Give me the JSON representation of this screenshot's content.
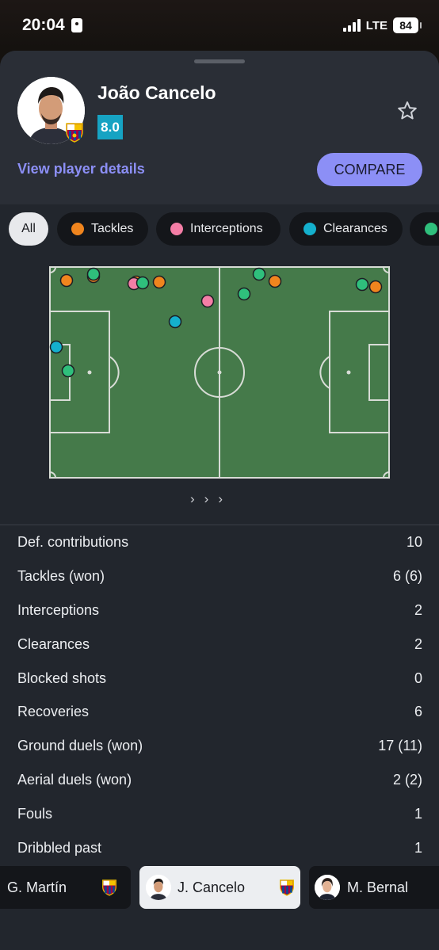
{
  "status_bar": {
    "time": "20:04",
    "network": "LTE",
    "battery": "84"
  },
  "player": {
    "name": "João Cancelo",
    "rating": "8.0",
    "details_link": "View player details",
    "compare_label": "COMPARE"
  },
  "filters": [
    {
      "label": "All",
      "color": ""
    },
    {
      "label": "Tackles",
      "color": "#f0851e"
    },
    {
      "label": "Interceptions",
      "color": "#f47ea6"
    },
    {
      "label": "Clearances",
      "color": "#14b0cd"
    },
    {
      "label": "",
      "color": "#2fbf7c"
    }
  ],
  "stats": [
    {
      "label": "Def. contributions",
      "value": "10"
    },
    {
      "label": "Tackles (won)",
      "value": "6 (6)"
    },
    {
      "label": "Interceptions",
      "value": "2"
    },
    {
      "label": "Clearances",
      "value": "2"
    },
    {
      "label": "Blocked shots",
      "value": "0"
    },
    {
      "label": "Recoveries",
      "value": "6"
    },
    {
      "label": "Ground duels (won)",
      "value": "17 (11)"
    },
    {
      "label": "Aerial duels (won)",
      "value": "2 (2)"
    },
    {
      "label": "Fouls",
      "value": "1"
    },
    {
      "label": "Dribbled past",
      "value": "1"
    }
  ],
  "bottom_players": [
    {
      "name": "G. Martín"
    },
    {
      "name": "J. Cancelo"
    },
    {
      "name": "M. Bernal"
    }
  ],
  "colors": {
    "accent": "#8c8ff6",
    "rating": "#16a3c3",
    "pitch": "#457a4a",
    "tackle": "#f0851e",
    "interception": "#f47ea6",
    "clearance": "#14b0cd",
    "recovery": "#2fbf7c"
  }
}
